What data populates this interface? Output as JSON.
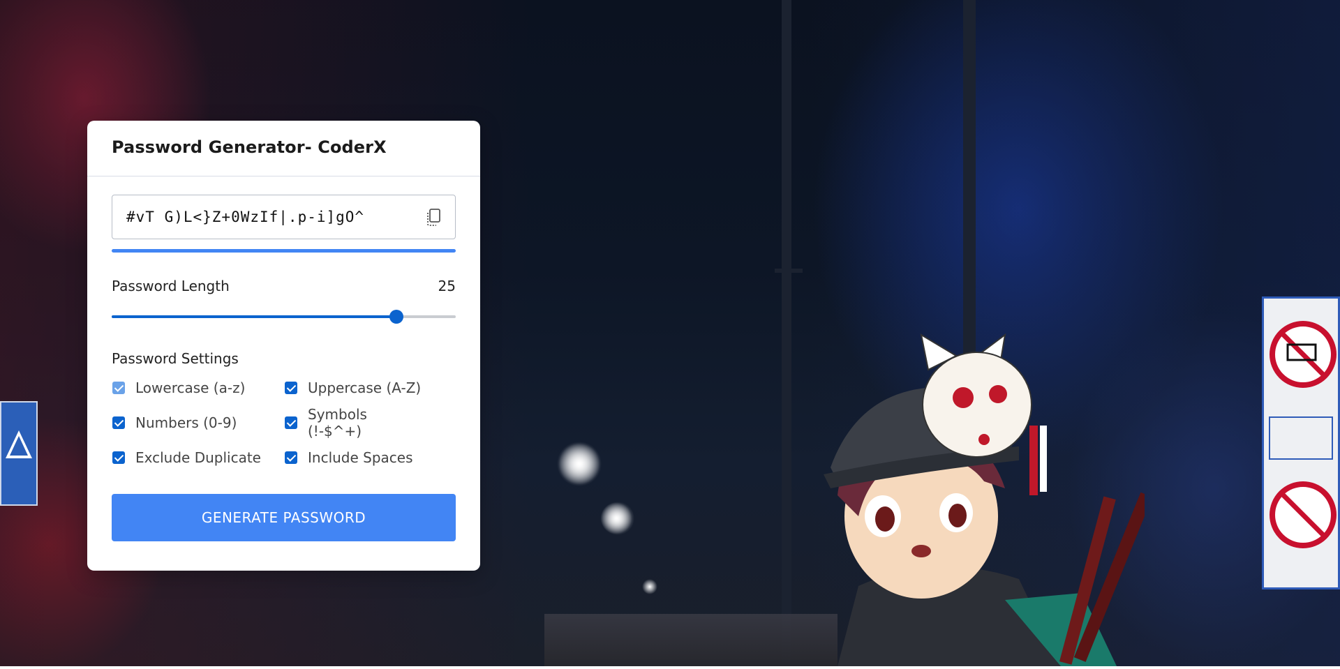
{
  "app": {
    "title": "Password Generator- CoderX"
  },
  "password": {
    "value": "#vT G)L<}Z+0WzIf|.p-i]gO^",
    "strength_fraction": 1.0
  },
  "length": {
    "label": "Password Length",
    "value": "25",
    "min": 1,
    "max": 30,
    "current": 25
  },
  "settings": {
    "title": "Password Settings",
    "options": [
      {
        "label": "Lowercase (a-z)",
        "checked": true,
        "disabled": true
      },
      {
        "label": "Uppercase (A-Z)",
        "checked": true,
        "disabled": false
      },
      {
        "label": "Numbers (0-9)",
        "checked": true,
        "disabled": false
      },
      {
        "label": "Symbols (!-$^+)",
        "checked": true,
        "disabled": false
      },
      {
        "label": "Exclude Duplicate",
        "checked": true,
        "disabled": false
      },
      {
        "label": "Include Spaces",
        "checked": true,
        "disabled": false
      }
    ]
  },
  "generate": {
    "label": "GENERATE PASSWORD"
  },
  "icons": {
    "copy": "copy-icon"
  },
  "colors": {
    "accent": "#4285f4",
    "checkbox": "#0b63ce",
    "card": "#ffffff"
  }
}
